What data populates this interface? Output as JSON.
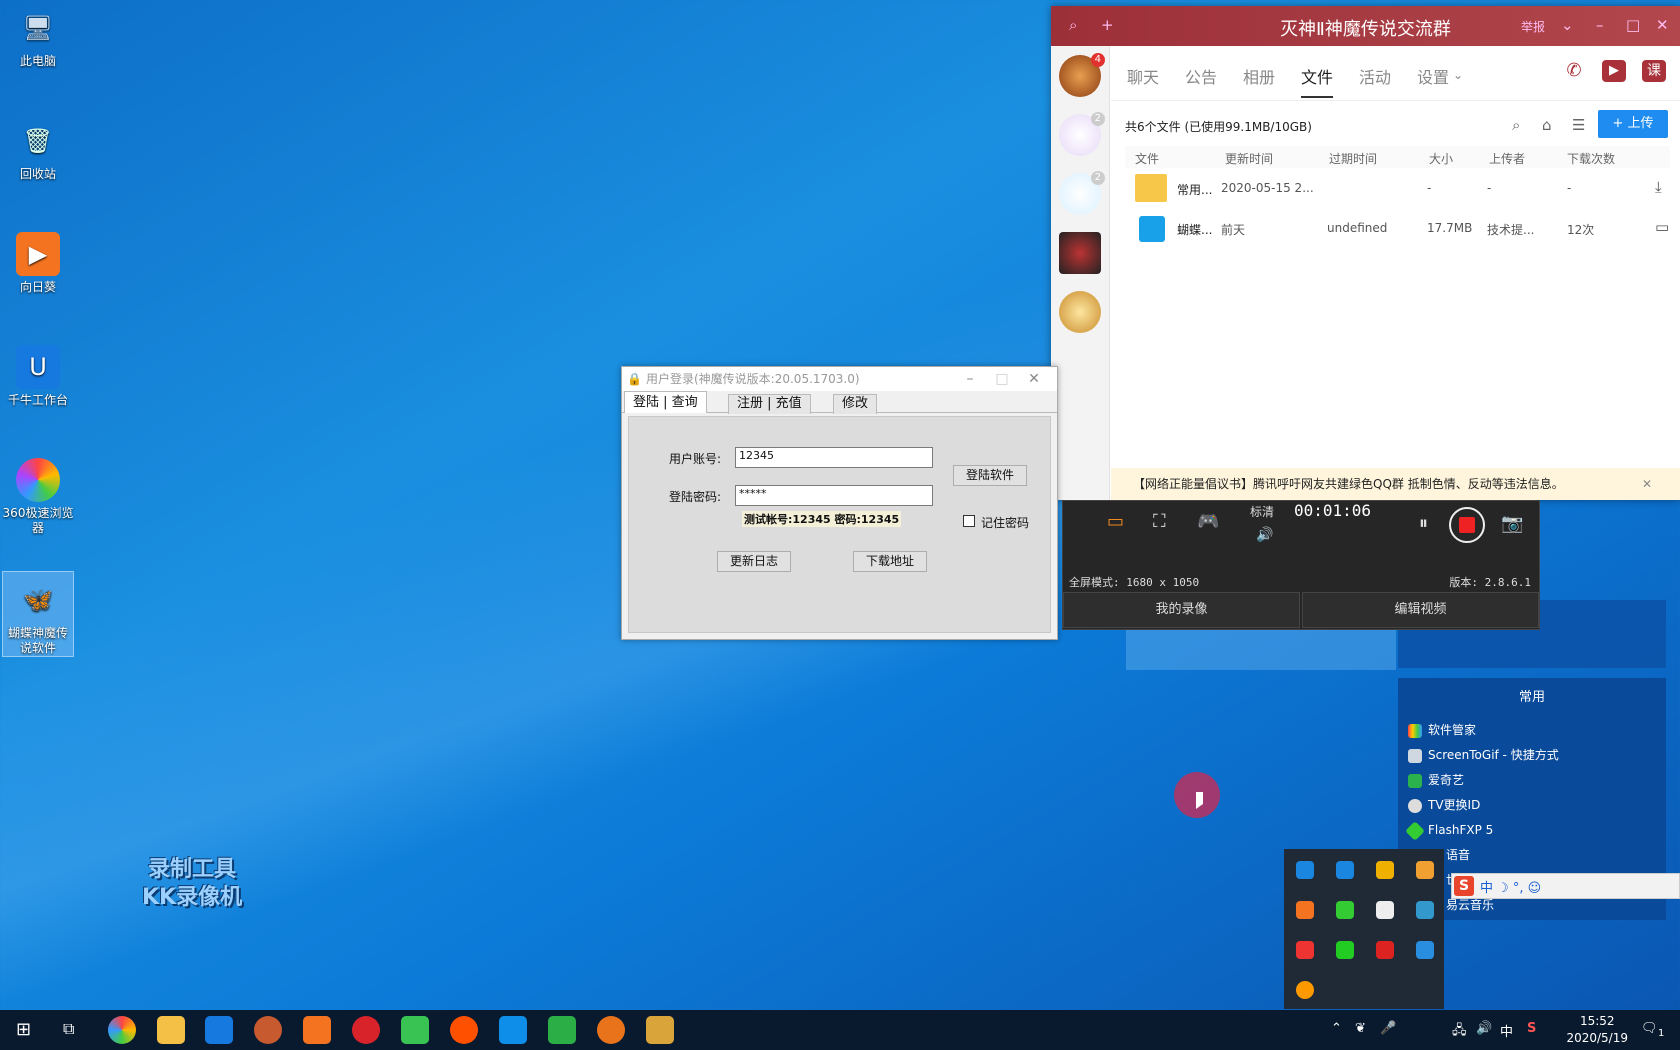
{
  "desktop": {
    "icons": [
      {
        "label": "此电脑"
      },
      {
        "label": "回收站"
      },
      {
        "label": "向日葵"
      },
      {
        "label": "千牛工作台"
      },
      {
        "label": "360极速浏览器"
      },
      {
        "label": "蝴蝶神魔传说软件"
      }
    ],
    "watermark": {
      "line1": "录制工具",
      "line2": "KK录像机"
    }
  },
  "qq": {
    "title": "灭神Ⅱ神魔传说交流群",
    "report": "举报",
    "badges": [
      "4",
      "2",
      "2"
    ],
    "tabs": [
      "聊天",
      "公告",
      "相册",
      "文件",
      "活动",
      "设置"
    ],
    "active_tab": "文件",
    "course": "课",
    "file_info": "共6个文件 (已使用99.1MB/10GB)",
    "upload": "+ 上传",
    "columns": [
      "文件",
      "更新时间",
      "过期时间",
      "大小",
      "上传者",
      "下载次数"
    ],
    "files": [
      {
        "name": "常用...",
        "time": "2020-05-15 2...",
        "expire": "",
        "size": "-",
        "uploader": "-",
        "downloads": "-"
      },
      {
        "name": "蝴蝶...",
        "time": "前天",
        "expire": "undefined",
        "size": "17.7MB",
        "uploader": "技术提...",
        "downloads": "12次"
      }
    ],
    "notice": "【网络正能量倡议书】腾讯呼吁网友共建绿色QQ群 抵制色情、反动等违法信息。"
  },
  "login": {
    "title": "用户登录(神魔传说版本:20.05.1703.0)",
    "tabs": [
      "登陆 | 查询",
      "注册 | 充值",
      "修改"
    ],
    "account_label": "用户账号:",
    "account_value": "12345",
    "password_label": "登陆密码:",
    "password_value": "*****",
    "hint": "测试帐号:12345  密码:12345",
    "login_button": "登陆软件",
    "remember": "记住密码",
    "changelog_button": "更新日志",
    "download_button": "下载地址"
  },
  "recorder": {
    "quality": "标清",
    "time": "00:01:06",
    "mode": "全屏模式: 1680 x 1050",
    "version": "版本: 2.8.6.1",
    "my_recordings": "我的录像",
    "edit_video": "编辑视频"
  },
  "start_menu": {
    "section": "常用",
    "items": [
      "软件管家",
      "ScreenToGif - 快捷方式",
      "爱奇艺",
      "TV更换ID",
      "FlashFXP 5",
      "语音",
      "世",
      "易云音乐"
    ]
  },
  "ime": {
    "text": "中 ☽ °, ☺"
  },
  "taskbar": {
    "time": "15:52",
    "date": "2020/5/19",
    "lang": "中",
    "notif": "1"
  },
  "colors": {
    "qq_title": "#a9323a",
    "accent": "#1e8cf0",
    "desktop": "#1a8fe0"
  }
}
